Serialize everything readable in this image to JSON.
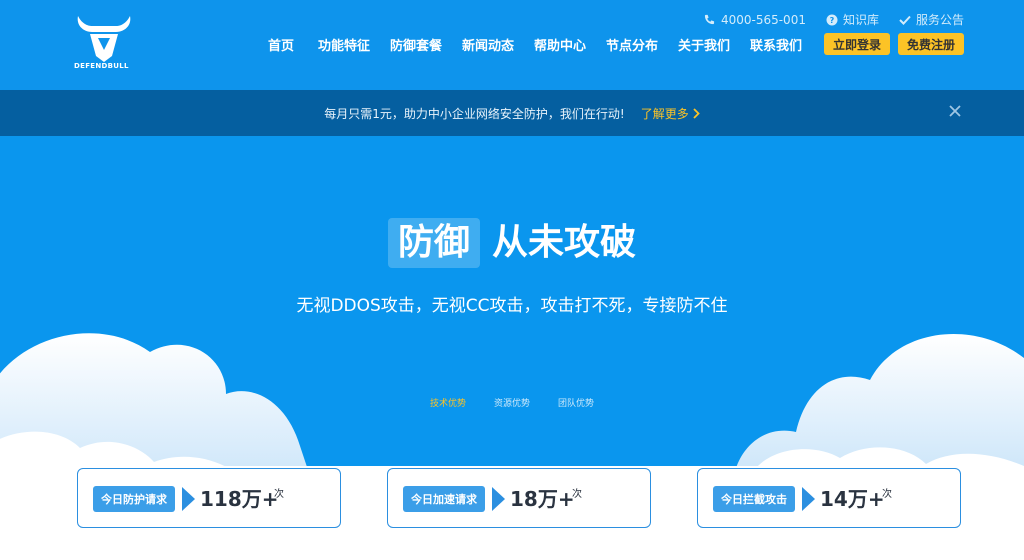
{
  "brand": {
    "logo_text": "DEFENDBULL"
  },
  "topbar": [
    {
      "icon": "phone-icon",
      "label": "4000-565-001"
    },
    {
      "icon": "question-icon",
      "label": "知识库"
    },
    {
      "icon": "check-icon",
      "label": "服务公告"
    }
  ],
  "nav": [
    "首页",
    "功能特征",
    "防御套餐",
    "新闻动态",
    "帮助中心",
    "节点分布",
    "关于我们",
    "联系我们"
  ],
  "buttons": {
    "login": "立即登录",
    "register": "免费注册"
  },
  "notice": {
    "text": "每月只需1元，助力中小企业网络安全防护，我们在行动!",
    "more": "了解更多"
  },
  "hero": {
    "title_boxed": "防御",
    "title_rest": "从未攻破",
    "subtitle": "无视DDOS攻击，无视CC攻击，攻击打不死，专接防不住"
  },
  "tabs": [
    {
      "label": "技术优势",
      "active": true
    },
    {
      "label": "资源优势",
      "active": false
    },
    {
      "label": "团队优势",
      "active": false
    }
  ],
  "stats": [
    {
      "label": "今日防护请求",
      "value": "118万+",
      "unit": "次"
    },
    {
      "label": "今日加速请求",
      "value": "18万+",
      "unit": "次"
    },
    {
      "label": "今日拦截攻击",
      "value": "14万+",
      "unit": "次"
    }
  ],
  "colors": {
    "primary": "#0e94ec",
    "notice_bg": "#055fa0",
    "accent": "#fcc326",
    "card_border": "#2b8fe0"
  }
}
